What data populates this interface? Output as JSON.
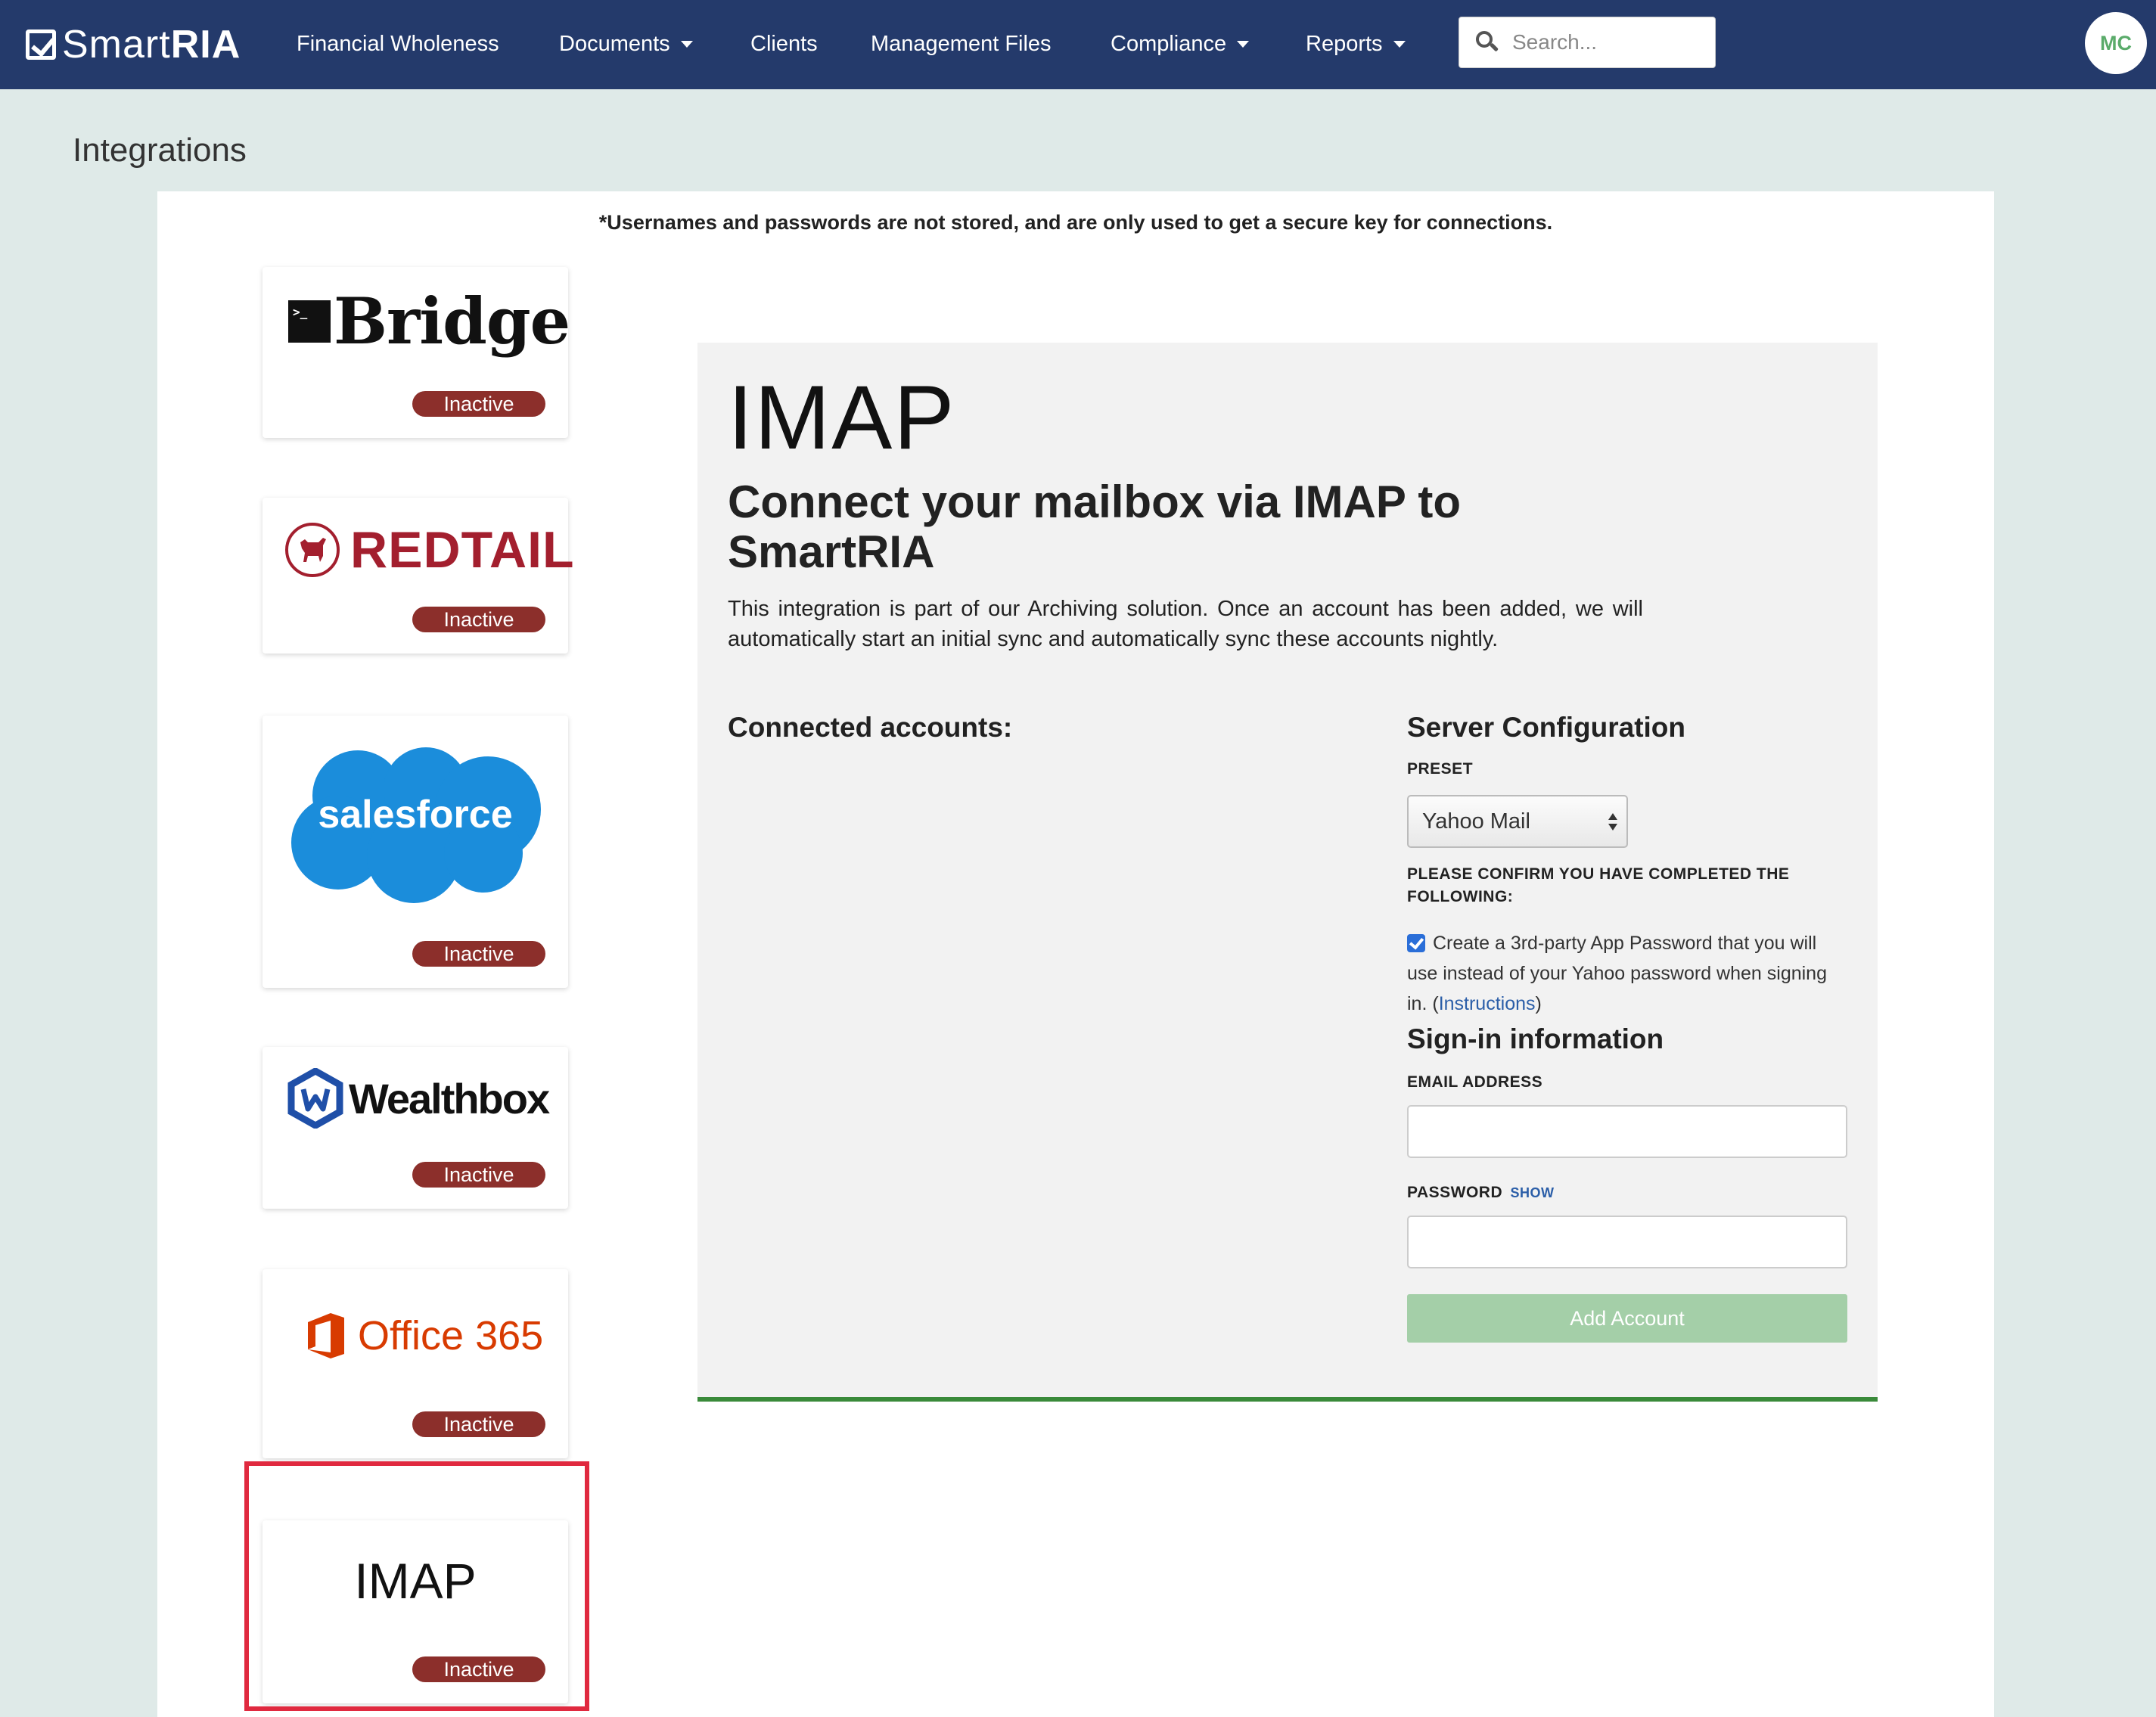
{
  "app": {
    "logo_smart": "Smart",
    "logo_ria": "RIA"
  },
  "nav": {
    "items": [
      {
        "label": "Financial Wholeness",
        "dropdown": false
      },
      {
        "label": "Documents",
        "dropdown": true
      },
      {
        "label": "Clients",
        "dropdown": false
      },
      {
        "label": "Management Files",
        "dropdown": false
      },
      {
        "label": "Compliance",
        "dropdown": true
      },
      {
        "label": "Reports",
        "dropdown": true
      }
    ],
    "search_placeholder": "Search...",
    "avatar_initials": "MC"
  },
  "page": {
    "title": "Integrations",
    "notice": "*Usernames and passwords are not stored, and are only used to get a secure key for connections."
  },
  "integrations": [
    {
      "name": "Bridge",
      "status": "Inactive"
    },
    {
      "name": "REDTAIL",
      "status": "Inactive"
    },
    {
      "name": "salesforce",
      "status": "Inactive"
    },
    {
      "name": "Wealthbox",
      "status": "Inactive"
    },
    {
      "name": "Office 365",
      "status": "Inactive"
    },
    {
      "name": "IMAP",
      "status": "Inactive"
    }
  ],
  "panel": {
    "title": "IMAP",
    "subtitle": "Connect your mailbox via IMAP to SmartRIA",
    "description": "This integration is part of our Archiving solution. Once an account has been added, we will automatically start an initial sync and automatically sync these accounts nightly.",
    "connected_heading": "Connected accounts:",
    "server_heading": "Server Configuration",
    "preset_label": "PRESET",
    "preset_value": "Yahoo Mail",
    "confirm_label": "PLEASE CONFIRM YOU HAVE COMPLETED THE FOLLOWING:",
    "confirm_text": "Create a 3rd-party App Password that you will use instead of your Yahoo password when signing in. (",
    "confirm_link": "Instructions",
    "confirm_close": ")",
    "confirm_checked": true,
    "signin_heading": "Sign-in information",
    "email_label": "EMAIL ADDRESS",
    "password_label": "PASSWORD",
    "show_label": "SHOW",
    "email_value": "",
    "password_value": "",
    "add_button": "Add Account"
  },
  "colors": {
    "nav_bg": "#243a6b",
    "badge_inactive": "#8c2f2b",
    "add_button": "#a4cfa8",
    "highlight": "#e0293f",
    "panel_accent": "#3a8a3a"
  }
}
